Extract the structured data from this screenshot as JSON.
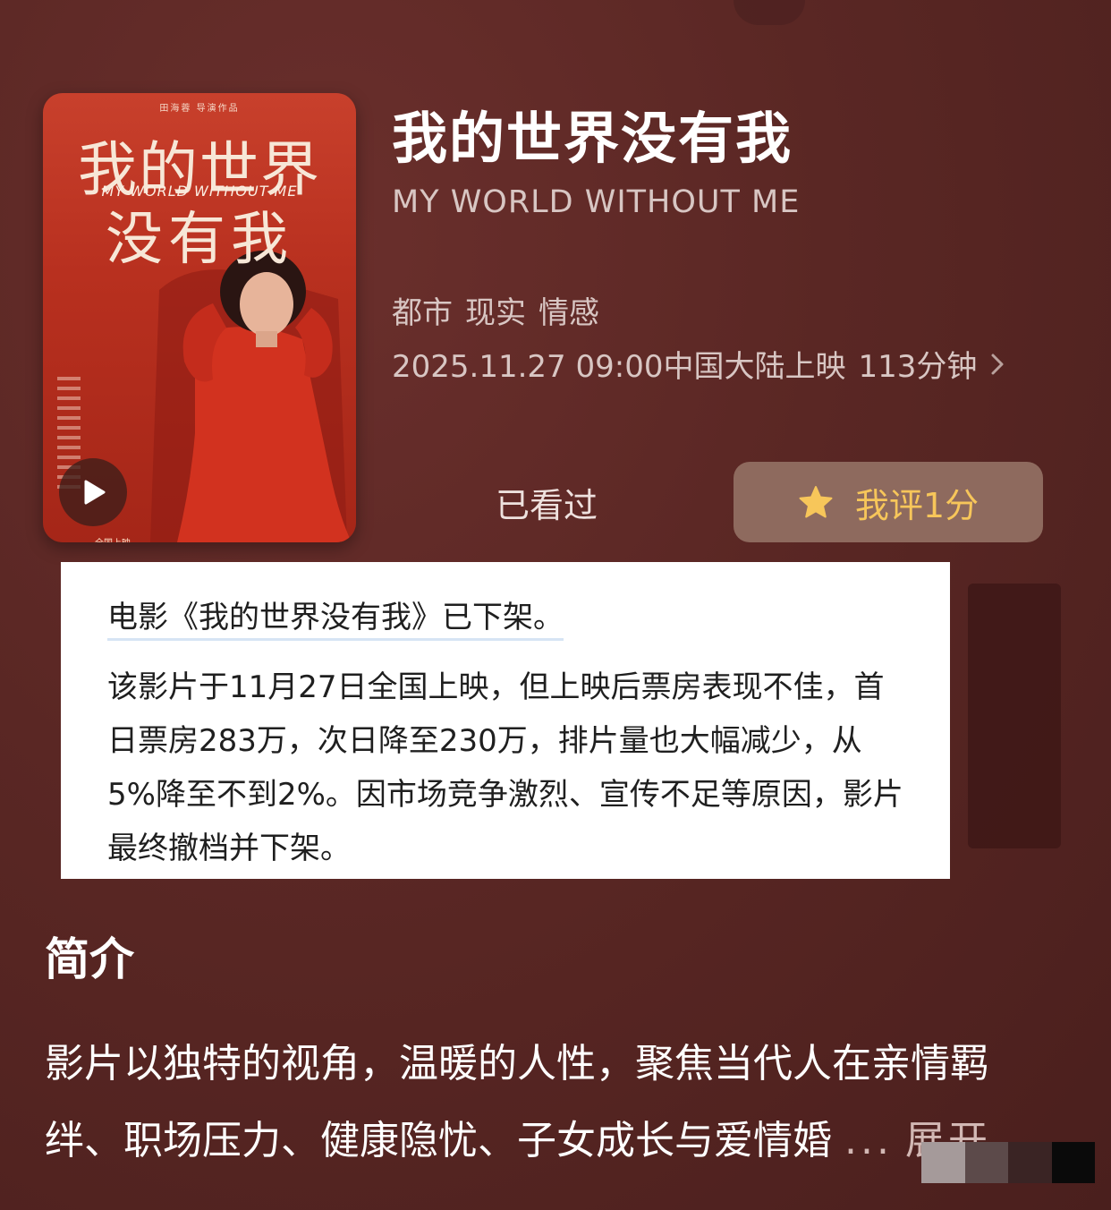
{
  "movie": {
    "title": "我的世界没有我",
    "english_title": "MY WORLD WITHOUT ME",
    "genres": [
      "都市",
      "现实",
      "情感"
    ],
    "release_date": "2025.11.27 09:00中国大陆上映",
    "runtime": "113分钟"
  },
  "poster": {
    "credit_line": "田海蓉 导演作品",
    "title_line1": "我的世界",
    "title_line2": "没有我",
    "subtitle": "MY WORLD WITHOUT ME",
    "tag": "全国上映"
  },
  "actions": {
    "watched_label": "已看过",
    "rate_label": "我评1分"
  },
  "notice": {
    "headline": "电影《我的世界没有我》已下架。",
    "body": "该影片于11月27日全国上映，但上映后票房表现不佳，首日票房283万，次日降至230万，排片量也大幅减少，从5%降至不到2%。因市场竞争激烈、宣传不足等原因，影片最终撤档并下架。"
  },
  "synopsis": {
    "heading": "简介",
    "line1": "影片以独特的视角，温暖的人性，聚焦当代人在亲情羁",
    "line2": "绊、职场压力、健康隐忧、子女成长与爱情婚",
    "ellipsis": "...",
    "expand_label": "展开"
  },
  "colors": {
    "background": "#5a2724",
    "rate_button": "#8e6a5e",
    "star": "#f7c65a",
    "poster_red": "#c8402c"
  },
  "icons": {
    "play": "play-icon",
    "star": "star-icon",
    "chevron": "chevron-right-icon"
  }
}
